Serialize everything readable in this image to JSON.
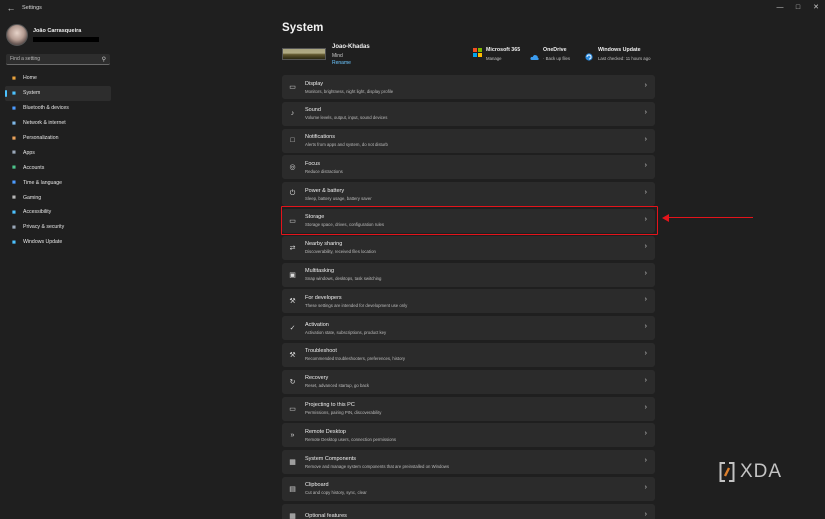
{
  "window": {
    "app_title": "Settings",
    "back_icon": "back-arrow-icon",
    "controls": [
      "minimize-icon",
      "maximize-icon",
      "close-icon"
    ]
  },
  "profile": {
    "name": "João Carrasqueira"
  },
  "search": {
    "placeholder": "Find a setting"
  },
  "sidebar": {
    "items": [
      {
        "label": "Home",
        "icon": "home-icon",
        "color": "#e8a23c"
      },
      {
        "label": "System",
        "icon": "system-icon",
        "color": "#4cc2ff",
        "active": true
      },
      {
        "label": "Bluetooth & devices",
        "icon": "bluetooth-icon",
        "color": "#4c9bff"
      },
      {
        "label": "Network & internet",
        "icon": "network-icon",
        "color": "#7fb8e8"
      },
      {
        "label": "Personalization",
        "icon": "personalization-icon",
        "color": "#e9a15a"
      },
      {
        "label": "Apps",
        "icon": "apps-icon",
        "color": "#9aa7b8"
      },
      {
        "label": "Accounts",
        "icon": "accounts-icon",
        "color": "#4cc38a"
      },
      {
        "label": "Time & language",
        "icon": "time-language-icon",
        "color": "#4c9bff"
      },
      {
        "label": "Gaming",
        "icon": "gaming-icon",
        "color": "#b6b6b6"
      },
      {
        "label": "Accessibility",
        "icon": "accessibility-icon",
        "color": "#4cc2ff"
      },
      {
        "label": "Privacy & security",
        "icon": "shield-icon",
        "color": "#9aa7b8"
      },
      {
        "label": "Windows Update",
        "icon": "windows-update-icon",
        "color": "#4cc2ff"
      }
    ]
  },
  "main": {
    "title": "System",
    "device": {
      "name": "Joao-Khadas",
      "model": "Mind",
      "rename": "Rename"
    },
    "quick": [
      {
        "title": "Microsoft 365",
        "sub": "Manage",
        "icon": "microsoft-365-icon"
      },
      {
        "title": "OneDrive",
        "sub": "· Back up files",
        "icon": "onedrive-icon"
      },
      {
        "title": "Windows Update",
        "sub": "Last checked: 11 hours ago",
        "icon": "windows-update-icon"
      }
    ],
    "rows": [
      {
        "title": "Display",
        "sub": "Monitors, brightness, night light, display profile",
        "icon": "display-icon",
        "glyph": "▭"
      },
      {
        "title": "Sound",
        "sub": "Volume levels, output, input, sound devices",
        "icon": "sound-icon",
        "glyph": "♪"
      },
      {
        "title": "Notifications",
        "sub": "Alerts from apps and system, do not disturb",
        "icon": "bell-icon",
        "glyph": "□"
      },
      {
        "title": "Focus",
        "sub": "Reduce distractions",
        "icon": "focus-icon",
        "glyph": "◎"
      },
      {
        "title": "Power & battery",
        "sub": "Sleep, battery usage, battery saver",
        "icon": "power-icon",
        "glyph": "⏻"
      },
      {
        "title": "Storage",
        "sub": "Storage space, drives, configuration rules",
        "icon": "storage-icon",
        "glyph": "▭"
      },
      {
        "title": "Nearby sharing",
        "sub": "Discoverability, received files location",
        "icon": "nearby-sharing-icon",
        "glyph": "⇄"
      },
      {
        "title": "Multitasking",
        "sub": "Snap windows, desktops, task switching",
        "icon": "multitasking-icon",
        "glyph": "▣"
      },
      {
        "title": "For developers",
        "sub": "These settings are intended for development use only",
        "icon": "developer-icon",
        "glyph": "⚒"
      },
      {
        "title": "Activation",
        "sub": "Activation state, subscriptions, product key",
        "icon": "activation-icon",
        "glyph": "✓"
      },
      {
        "title": "Troubleshoot",
        "sub": "Recommended troubleshooters, preferences, history",
        "icon": "wrench-icon",
        "glyph": "⚒"
      },
      {
        "title": "Recovery",
        "sub": "Reset, advanced startup, go back",
        "icon": "recovery-icon",
        "glyph": "↻"
      },
      {
        "title": "Projecting to this PC",
        "sub": "Permissions, pairing PIN, discoverability",
        "icon": "projecting-icon",
        "glyph": "▭"
      },
      {
        "title": "Remote Desktop",
        "sub": "Remote Desktop users, connection permissions",
        "icon": "remote-desktop-icon",
        "glyph": "»"
      },
      {
        "title": "System Components",
        "sub": "Remove and manage system components that are preinstalled on Windows",
        "icon": "components-icon",
        "glyph": "▦"
      },
      {
        "title": "Clipboard",
        "sub": "Cut and copy history, sync, clear",
        "icon": "clipboard-icon",
        "glyph": "▤"
      },
      {
        "title": "Optional features",
        "sub": "",
        "icon": "optional-features-icon",
        "glyph": "▦"
      }
    ]
  },
  "annotation": {
    "color": "#e4141b",
    "highlighted_row": "Storage"
  },
  "watermark": {
    "text": "XDA"
  }
}
